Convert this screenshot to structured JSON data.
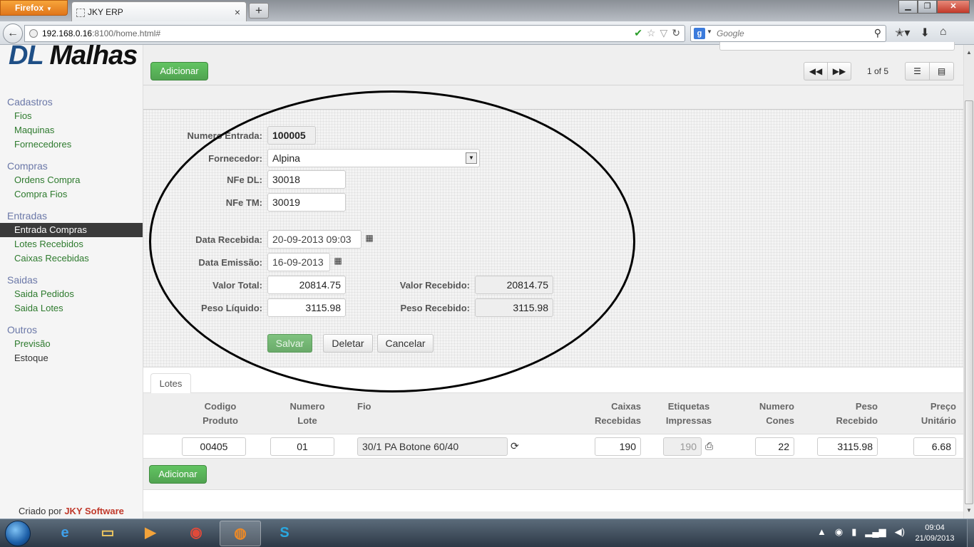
{
  "browser": {
    "menu_button": "Firefox",
    "tab_title": "JKY ERP",
    "url_host": "192.168.0.16",
    "url_rest": ":8100/home.html#",
    "search_placeholder": "Google"
  },
  "sidebar": {
    "logo_prefix": "DL",
    "logo_suffix": "Malhas",
    "groups": [
      {
        "title": "Cadastros",
        "items": [
          {
            "label": "Fios"
          },
          {
            "label": "Maquinas"
          },
          {
            "label": "Fornecedores"
          }
        ]
      },
      {
        "title": "Compras",
        "items": [
          {
            "label": "Ordens Compra"
          },
          {
            "label": "Compra Fios"
          }
        ]
      },
      {
        "title": "Entradas",
        "items": [
          {
            "label": "Entrada Compras",
            "active": true
          },
          {
            "label": "Lotes Recebidos"
          },
          {
            "label": "Caixas Recebidas"
          }
        ]
      },
      {
        "title": "Saidas",
        "items": [
          {
            "label": "Saida Pedidos"
          },
          {
            "label": "Saida Lotes"
          }
        ]
      },
      {
        "title": "Outros",
        "items": [
          {
            "label": "Previsão"
          },
          {
            "label": "Estoque"
          }
        ]
      }
    ],
    "credit_prefix": "Criado por",
    "credit_brand": "JKY Software"
  },
  "toolbar": {
    "add_label": "Adicionar",
    "page_info": "1 of 5"
  },
  "form": {
    "numero_entrada_label": "Numero Entrada:",
    "numero_entrada_value": "100005",
    "fornecedor_label": "Fornecedor:",
    "fornecedor_value": "Alpina",
    "nfe_dl_label": "NFe DL:",
    "nfe_dl_value": "30018",
    "nfe_tm_label": "NFe TM:",
    "nfe_tm_value": "30019",
    "data_recebida_label": "Data Recebida:",
    "data_recebida_value": "20-09-2013 09:03",
    "data_emissao_label": "Data Emissão:",
    "data_emissao_value": "16-09-2013",
    "valor_total_label": "Valor Total:",
    "valor_total_value": "20814.75",
    "valor_recebido_label": "Valor Recebido:",
    "valor_recebido_value": "20814.75",
    "peso_liquido_label": "Peso Líquido:",
    "peso_liquido_value": "3115.98",
    "peso_recebido_label": "Peso Recebido:",
    "peso_recebido_value": "3115.98",
    "save_label": "Salvar",
    "delete_label": "Deletar",
    "cancel_label": "Cancelar"
  },
  "lotes": {
    "tab_label": "Lotes",
    "headers": {
      "codigo_1": "Codigo",
      "codigo_2": "Produto",
      "numero_1": "Numero",
      "numero_2": "Lote",
      "fio": "Fio",
      "caixas_1": "Caixas",
      "caixas_2": "Recebidas",
      "etiquetas_1": "Etiquetas",
      "etiquetas_2": "Impressas",
      "cones_1": "Numero",
      "cones_2": "Cones",
      "peso_1": "Peso",
      "peso_2": "Recebido",
      "preco_1": "Preço",
      "preco_2": "Unitário"
    },
    "rows": [
      {
        "codigo": "00405",
        "lote": "01",
        "fio": "30/1 PA Botone 60/40",
        "caixas": "190",
        "etiquetas": "190",
        "cones": "22",
        "peso": "3115.98",
        "preco": "6.68"
      }
    ],
    "add_label": "Adicionar"
  },
  "taskbar": {
    "time": "09:04",
    "date": "21/09/2013"
  }
}
